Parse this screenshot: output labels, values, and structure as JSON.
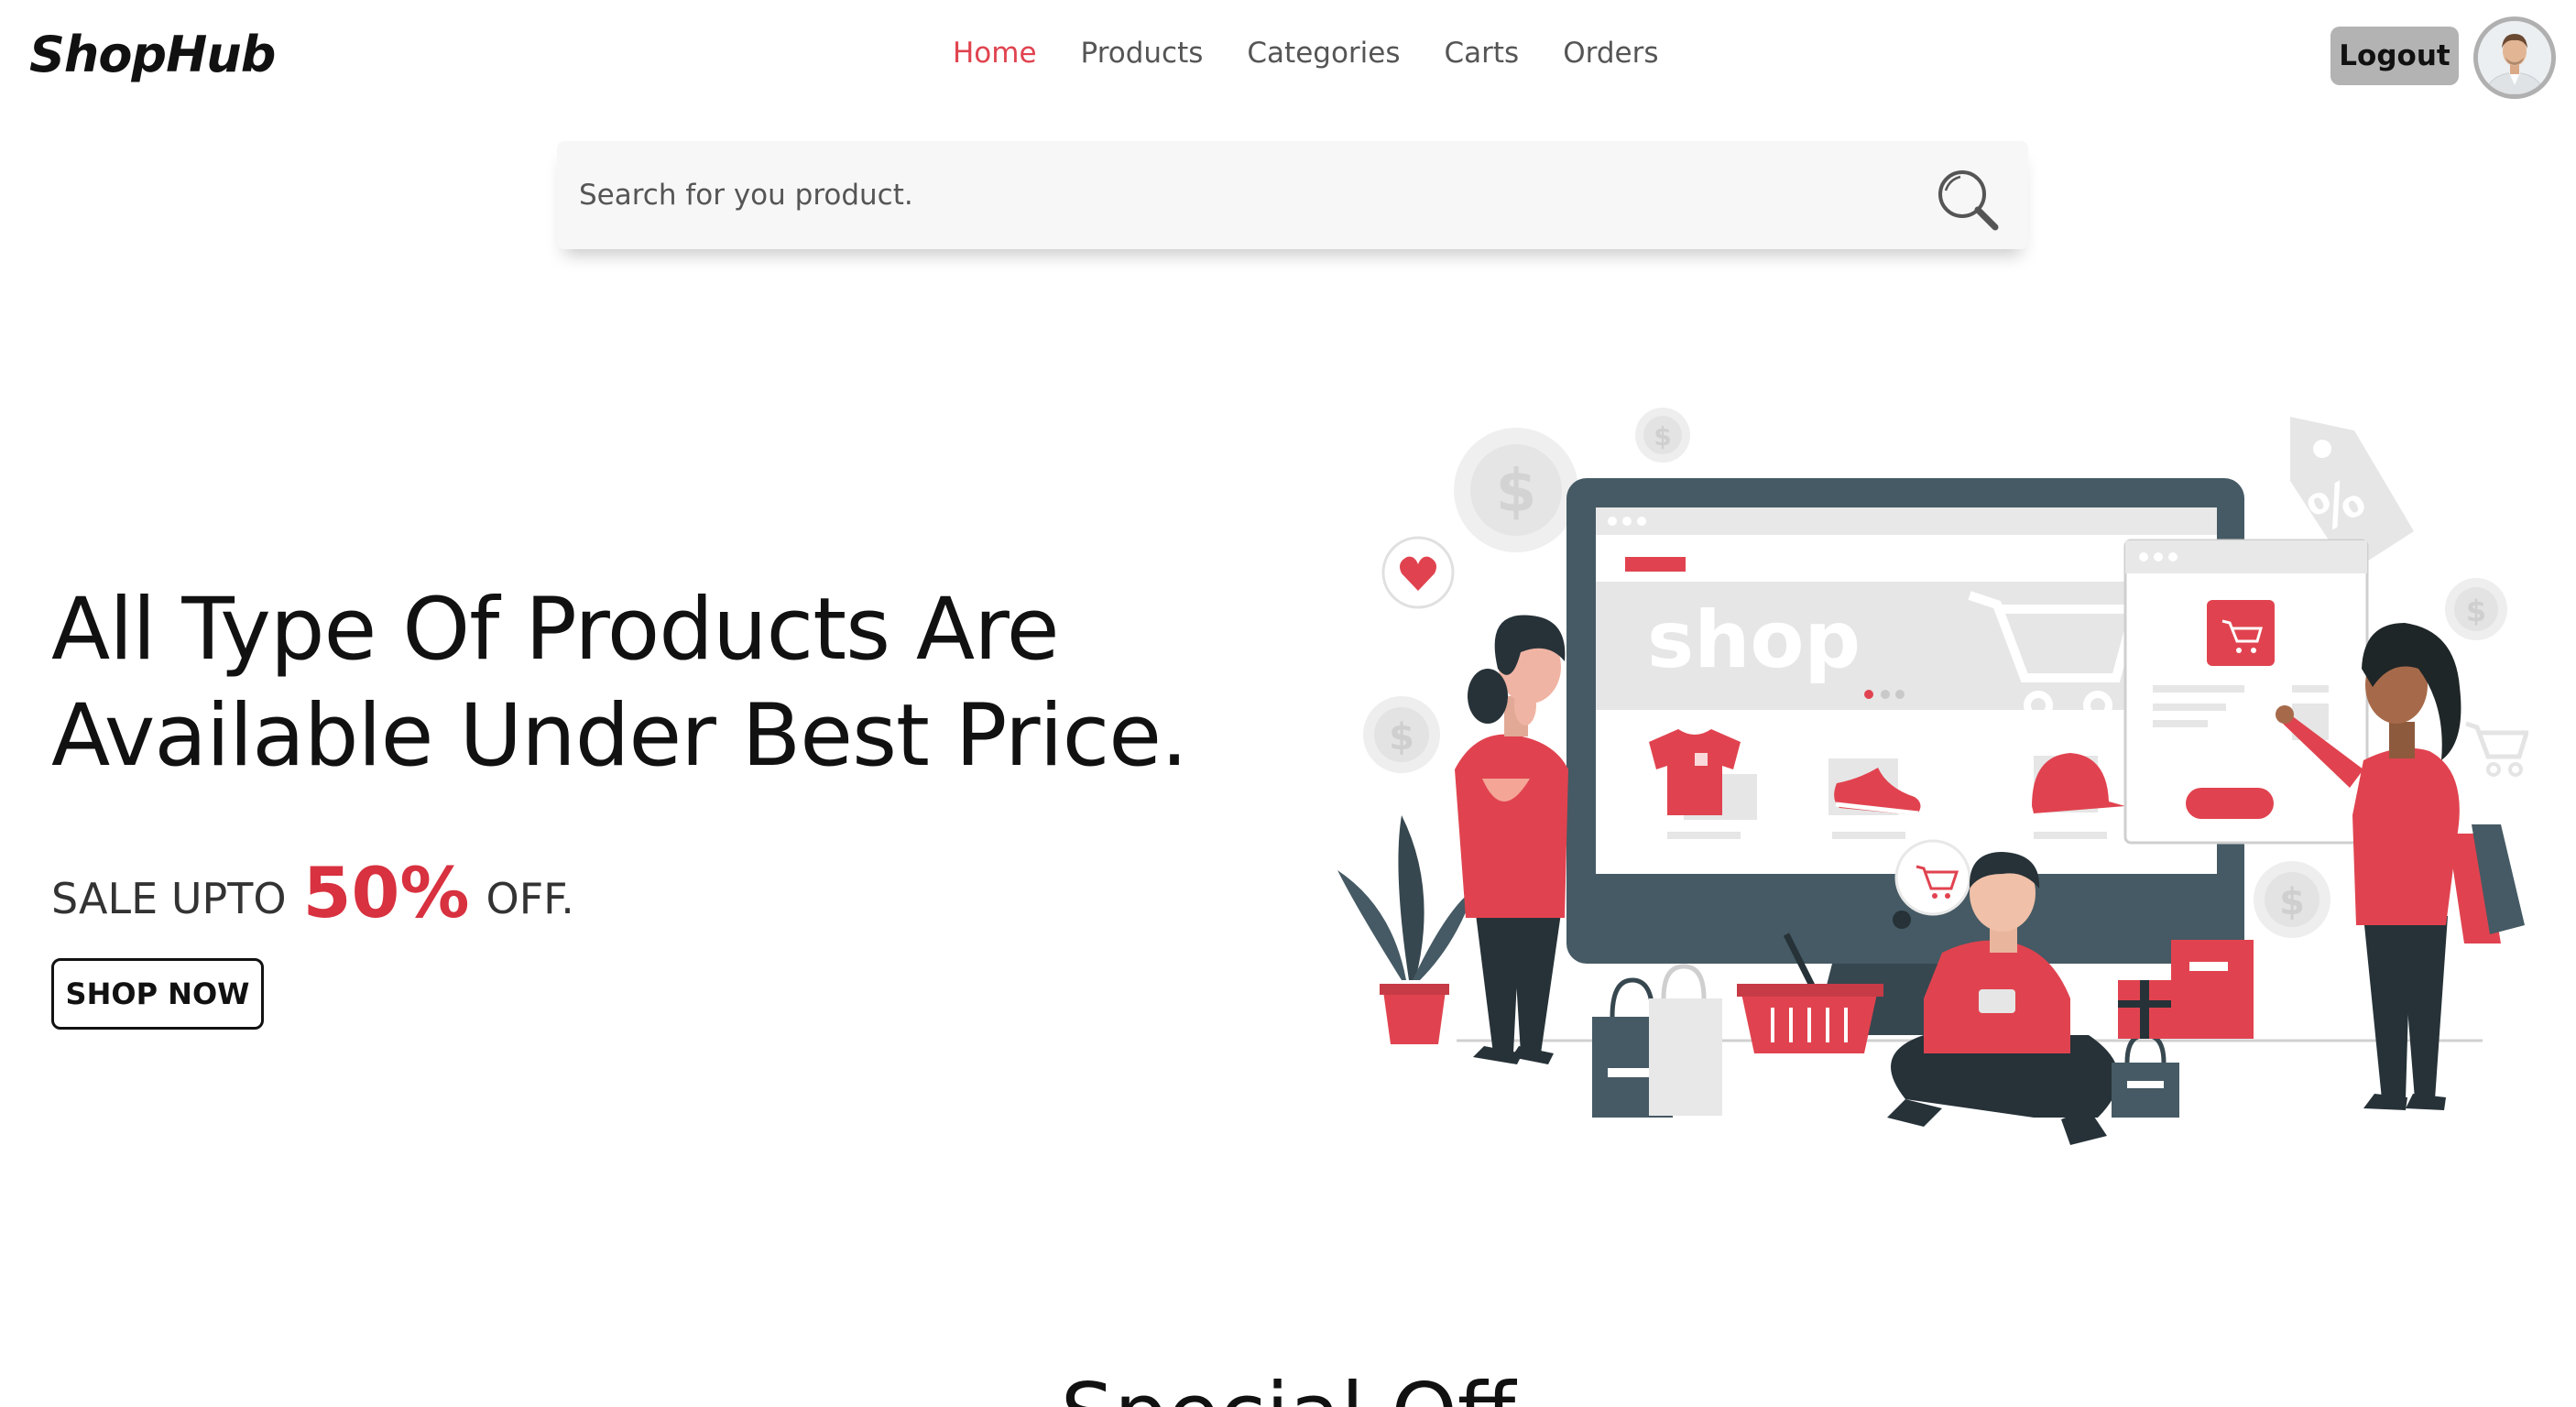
{
  "brand": {
    "logo_text": "ShopHub"
  },
  "nav": {
    "items": [
      {
        "label": "Home",
        "active": true
      },
      {
        "label": "Products",
        "active": false
      },
      {
        "label": "Categories",
        "active": false
      },
      {
        "label": "Carts",
        "active": false
      },
      {
        "label": "Orders",
        "active": false
      }
    ]
  },
  "header": {
    "logout_label": "Logout"
  },
  "search": {
    "placeholder": "Search for you product.",
    "value": ""
  },
  "hero": {
    "title_line1": "All Type Of Products Are",
    "title_line2": "Available Under Best Price.",
    "sale_prefix": "SALE UPTO",
    "sale_percent": "50%",
    "sale_suffix": "OFF.",
    "cta_label": "SHOP NOW",
    "illustration_text": "shop"
  },
  "section": {
    "title": "Special Off"
  },
  "colors": {
    "accent": "#e0434f",
    "sale": "#d8313f",
    "dark": "#455a64"
  }
}
